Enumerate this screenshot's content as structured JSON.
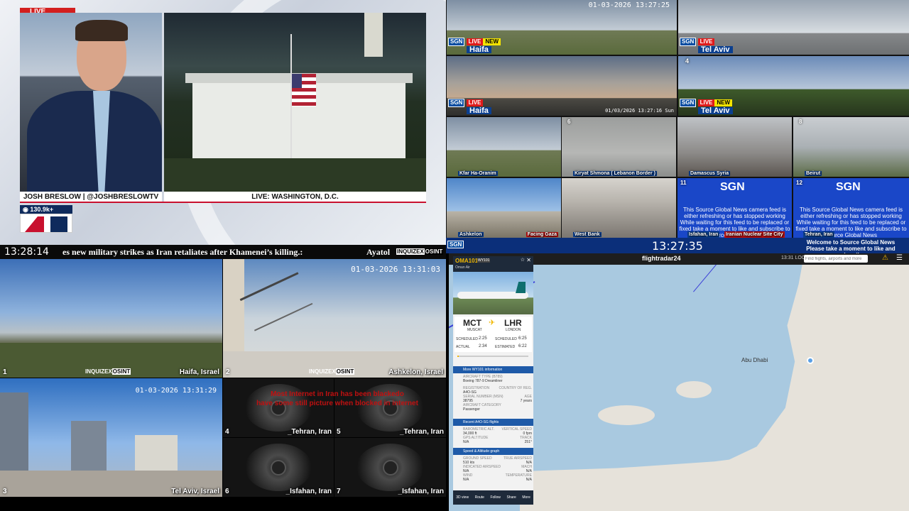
{
  "news": {
    "live": "LIVE",
    "anchor_caption": "JOSH BRESLOW | @JOSHBRESLOWTV",
    "location_caption": "LIVE: WASHINGTON, D.C.",
    "viewers": "130.9k+"
  },
  "ticker": {
    "clock": "13:28:14",
    "text": "es new military strikes as Iran retaliates after Khamenei’s killing.:",
    "next_text": "Ayatol",
    "brand_inquizex": "INQUIZEX",
    "brand_osint": "OSINT"
  },
  "sgn_grid": {
    "brand": "SGN",
    "live": "LIVE",
    "new": "NEW",
    "feeds": [
      {
        "num": "",
        "label": "Haifa",
        "timestamp": "01-03-2026 13:27:25"
      },
      {
        "num": "",
        "label": "Tel Aviv",
        "timestamp": ""
      },
      {
        "num": "",
        "label": "Haifa",
        "timestamp": "01/03/2026 13:27:16 Sun"
      },
      {
        "num": "4",
        "label": "Tel Aviv",
        "timestamp": ""
      },
      {
        "num": "",
        "label": "Kfar Ha-Oranim"
      },
      {
        "num": "6",
        "label": "Kiryat Shmona ( Lebanon Border )"
      },
      {
        "num": "",
        "label": "Damascus Syria"
      },
      {
        "num": "8",
        "label": "Beirut"
      },
      {
        "num": "",
        "label": "Ashkelon"
      },
      {
        "num": "",
        "label": "West Bank"
      },
      {
        "num": "11",
        "label": "Isfahan, Iran",
        "extra": "Iranian Nuclear Site City"
      },
      {
        "num": "12",
        "label": "Tehran, Iran"
      }
    ],
    "facing_gaza": "Facing Gaza",
    "card_text_1": "This Source Global News camera feed is either refreshing or has stopped working",
    "card_text_2": "While waiting for this feed to be replaced or fixed take a moment to like and subscribe to Source Global News",
    "bottom_text": "Welcome to Source Global News",
    "bottom_text_2": "Please take a moment to like and subscribe",
    "clock": "13:27:35"
  },
  "inquizex_grid": {
    "feeds": [
      {
        "num": "1",
        "label": "Haifa, Israel"
      },
      {
        "num": "2",
        "label": "Ashkelon, Israel",
        "timestamp": "01-03-2026 13:31:03"
      },
      {
        "num": "3",
        "label": "Tel Aviv, Israel",
        "timestamp": "01-03-2026 13:31:29"
      },
      {
        "num": "4",
        "label": "_Tehran, Iran"
      },
      {
        "num": "5",
        "label": "_Tehran, Iran"
      },
      {
        "num": "6",
        "label": "_Isfahan, Iran"
      },
      {
        "num": "7",
        "label": "_Isfahan, Iran"
      }
    ],
    "red_notice_1": "Most Internet in Iran has been blackedo",
    "red_notice_2": "have some still picture when blocked in internet"
  },
  "flight": {
    "callsign": "OMA101",
    "badge": "WY101",
    "airline": "Oman Air",
    "brand": "flightradar24",
    "origin_code": "MCT",
    "origin_city": "MUSCAT",
    "dest_code": "LHR",
    "dest_city": "LONDON",
    "sched_dep_label": "SCHEDULED",
    "sched_dep": "2:25",
    "actual_dep_label": "ACTUAL",
    "actual_dep": "2:34",
    "sched_arr_label": "SCHEDULED",
    "sched_arr": "6:25",
    "est_arr_label": "ESTIMATED",
    "est_arr": "6:22",
    "progress": 0.02,
    "more_info": "More WY101 information",
    "aircraft_type_label": "AIRCRAFT TYPE (B789)",
    "aircraft_type": "Boeing 787-9 Dreamliner",
    "registration_label": "REGISTRATION",
    "registration": "A4O-SG",
    "country_label": "COUNTRY OF REG.",
    "msn_label": "SERIAL NUMBER (MSN)",
    "msn": "38795",
    "age_label": "AGE",
    "age": "7 years",
    "category_label": "AIRCRAFT CATEGORY",
    "category": "Passenger",
    "recent_flights": "Recent A4O-SG flights",
    "baro_alt_label": "BAROMETRIC ALT.",
    "baro_alt": "34,000 ft",
    "vspeed_label": "VERTICAL SPEED",
    "vspeed": "0 fpm",
    "gps_alt_label": "GPS ALTITUDE",
    "gps_alt": "N/A",
    "track_label": "TRACK",
    "track": "251°",
    "speed_graph": "Speed & Altitude graph",
    "ground_speed_label": "GROUND SPEED",
    "ground_speed": "510 kts",
    "true_airspeed_label": "TRUE AIRSPEED",
    "true_airspeed": "N/A",
    "ind_airspeed_label": "INDICATED AIRSPEED",
    "ind_airspeed": "N/A",
    "mach_label": "MACH",
    "mach": "N/A",
    "wind_label": "WIND",
    "wind": "N/A",
    "temp_label": "TEMPERATURE",
    "temp": "N/A",
    "nav": [
      "3D view",
      "Route",
      "Follow",
      "Share",
      "More"
    ],
    "map_city": "Abu Dhabi",
    "map_clock": "13:31 LOC",
    "search_placeholder": "Find flights, airports and more"
  }
}
